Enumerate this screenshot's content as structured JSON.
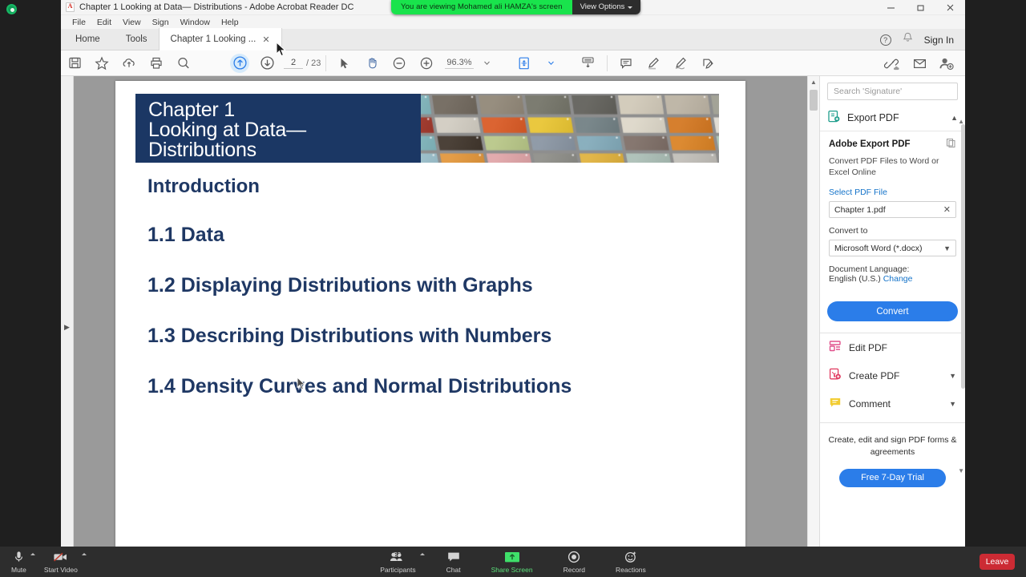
{
  "zoom_meeting": {
    "share_banner": {
      "message": "You are viewing Mohamed ali HAMZA's screen",
      "view_options_label": "View Options"
    },
    "toolbar": {
      "mute_label": "Mute",
      "start_video_label": "Start Video",
      "participants_label": "Participants",
      "participants_count": "33",
      "chat_label": "Chat",
      "share_screen_label": "Share Screen",
      "record_label": "Record",
      "reactions_label": "Reactions",
      "leave_label": "Leave"
    },
    "colors": {
      "share_green": "#19e34c",
      "leave_red": "#cc2b34",
      "bar_background": "#2d2d2d"
    }
  },
  "acrobat": {
    "window_title": "Chapter 1 Looking at Data— Distributions - Adobe Acrobat Reader DC",
    "window_controls": {
      "minimize": "minimize",
      "restore": "restore",
      "close": "close"
    },
    "menu": [
      "File",
      "Edit",
      "View",
      "Sign",
      "Window",
      "Help"
    ],
    "tabs": [
      {
        "label": "Home",
        "active": false
      },
      {
        "label": "Tools",
        "active": false
      },
      {
        "label": "Chapter 1 Looking ...",
        "active": true,
        "closable": true
      }
    ],
    "account": {
      "help_label": "?",
      "sign_in_label": "Sign In"
    },
    "toolbar": {
      "save_icon": "save-icon",
      "star_icon": "star-icon",
      "upload_cloud_icon": "upload-cloud-icon",
      "print_icon": "print-icon",
      "search_icon": "search-icon",
      "prev_page_icon": "previous-page-icon",
      "next_page_icon": "next-page-icon",
      "page_current": "2",
      "page_separator": "/",
      "page_total": "23",
      "select_tool_icon": "cursor-select-icon",
      "hand_tool_icon": "hand-pan-icon",
      "zoom_out_icon": "zoom-out-icon",
      "zoom_in_icon": "zoom-in-icon",
      "zoom_value": "96.3%",
      "fit_page_icon": "fit-page-icon",
      "keyboard_icon": "keyboard-icon",
      "comment_icon": "comment-icon",
      "highlight_icon": "highlight-icon",
      "draw_icon": "draw-icon",
      "sign_icon": "fill-and-sign-icon",
      "share_link_icon": "share-link-icon",
      "email_icon": "email-icon",
      "add_person_icon": "add-person-icon"
    },
    "tools_panel": {
      "search_placeholder": "Search 'Signature'",
      "export_section_title": "Export PDF",
      "export": {
        "heading": "Adobe Export PDF",
        "description": "Convert PDF Files to Word or Excel Online",
        "select_file_label": "Select PDF File",
        "selected_file": "Chapter 1.pdf",
        "convert_to_label": "Convert to",
        "convert_to_value": "Microsoft Word (*.docx)",
        "document_language_label": "Document Language:",
        "document_language_value": "English (U.S.)",
        "change_link": "Change",
        "convert_button": "Convert"
      },
      "tools": [
        {
          "label": "Edit PDF",
          "icon": "edit-pdf-icon",
          "expandable": false
        },
        {
          "label": "Create PDF",
          "icon": "create-pdf-icon",
          "expandable": true
        },
        {
          "label": "Comment",
          "icon": "comment-tool-icon",
          "expandable": true
        }
      ],
      "promo": {
        "text": "Create, edit and sign PDF forms & agreements",
        "button": "Free 7-Day Trial"
      }
    }
  },
  "document": {
    "slide_title_lines": [
      "Chapter 1",
      "Looking at Data—",
      "Distributions"
    ],
    "title_background": "#1b3764",
    "title_color": "#ffffff",
    "toc_color": "#1f3864",
    "toc": [
      "Introduction",
      "1.1 Data",
      "1.2 Displaying Distributions with Graphs",
      "1.3 Describing Distributions with Numbers",
      "1.4 Density Curves and Normal Distributions"
    ]
  }
}
